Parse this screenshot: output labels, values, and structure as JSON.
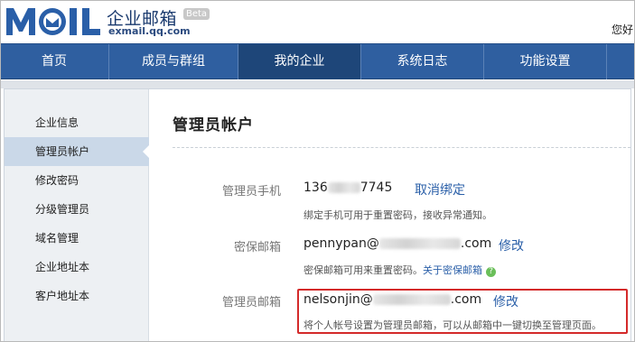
{
  "header": {
    "logo_text": "MOIL",
    "brand_cn": "企业邮箱",
    "brand_url": "exmail.qq.com",
    "beta": "Beta",
    "greeting": "您好"
  },
  "nav": {
    "items": [
      "首页",
      "成员与群组",
      "我的企业",
      "系统日志",
      "功能设置"
    ],
    "active_index": 2
  },
  "sidebar": {
    "items": [
      "企业信息",
      "管理员帐户",
      "修改密码",
      "分级管理员",
      "域名管理",
      "企业地址本",
      "客户地址本"
    ],
    "active_index": 1
  },
  "main": {
    "title": "管理员帐户",
    "rows": [
      {
        "label": "管理员手机",
        "value_prefix": "136",
        "value_suffix": "7745",
        "action": "取消绑定",
        "hint": "绑定手机可用于重置密码，接收异常通知。"
      },
      {
        "label": "密保邮箱",
        "value_prefix": "pennypan@",
        "value_suffix": ".com",
        "action": "修改",
        "hint": "密保邮箱可用来重置密码。",
        "hint_link": "关于密保邮箱",
        "help_icon": "?"
      },
      {
        "label": "管理员邮箱",
        "value_prefix": "nelsonjin@",
        "value_suffix": ".com",
        "action": "修改",
        "hint": "将个人帐号设置为管理员邮箱，可以从邮箱中一键切换至管理页面。"
      }
    ]
  },
  "colors": {
    "nav_bg": "#2f5fa0",
    "nav_active": "#1e4679",
    "link": "#2a5fa8",
    "highlight": "#d42a2a",
    "sidebar_bg": "#edf0f3",
    "sidebar_active": "#cad8e8"
  }
}
